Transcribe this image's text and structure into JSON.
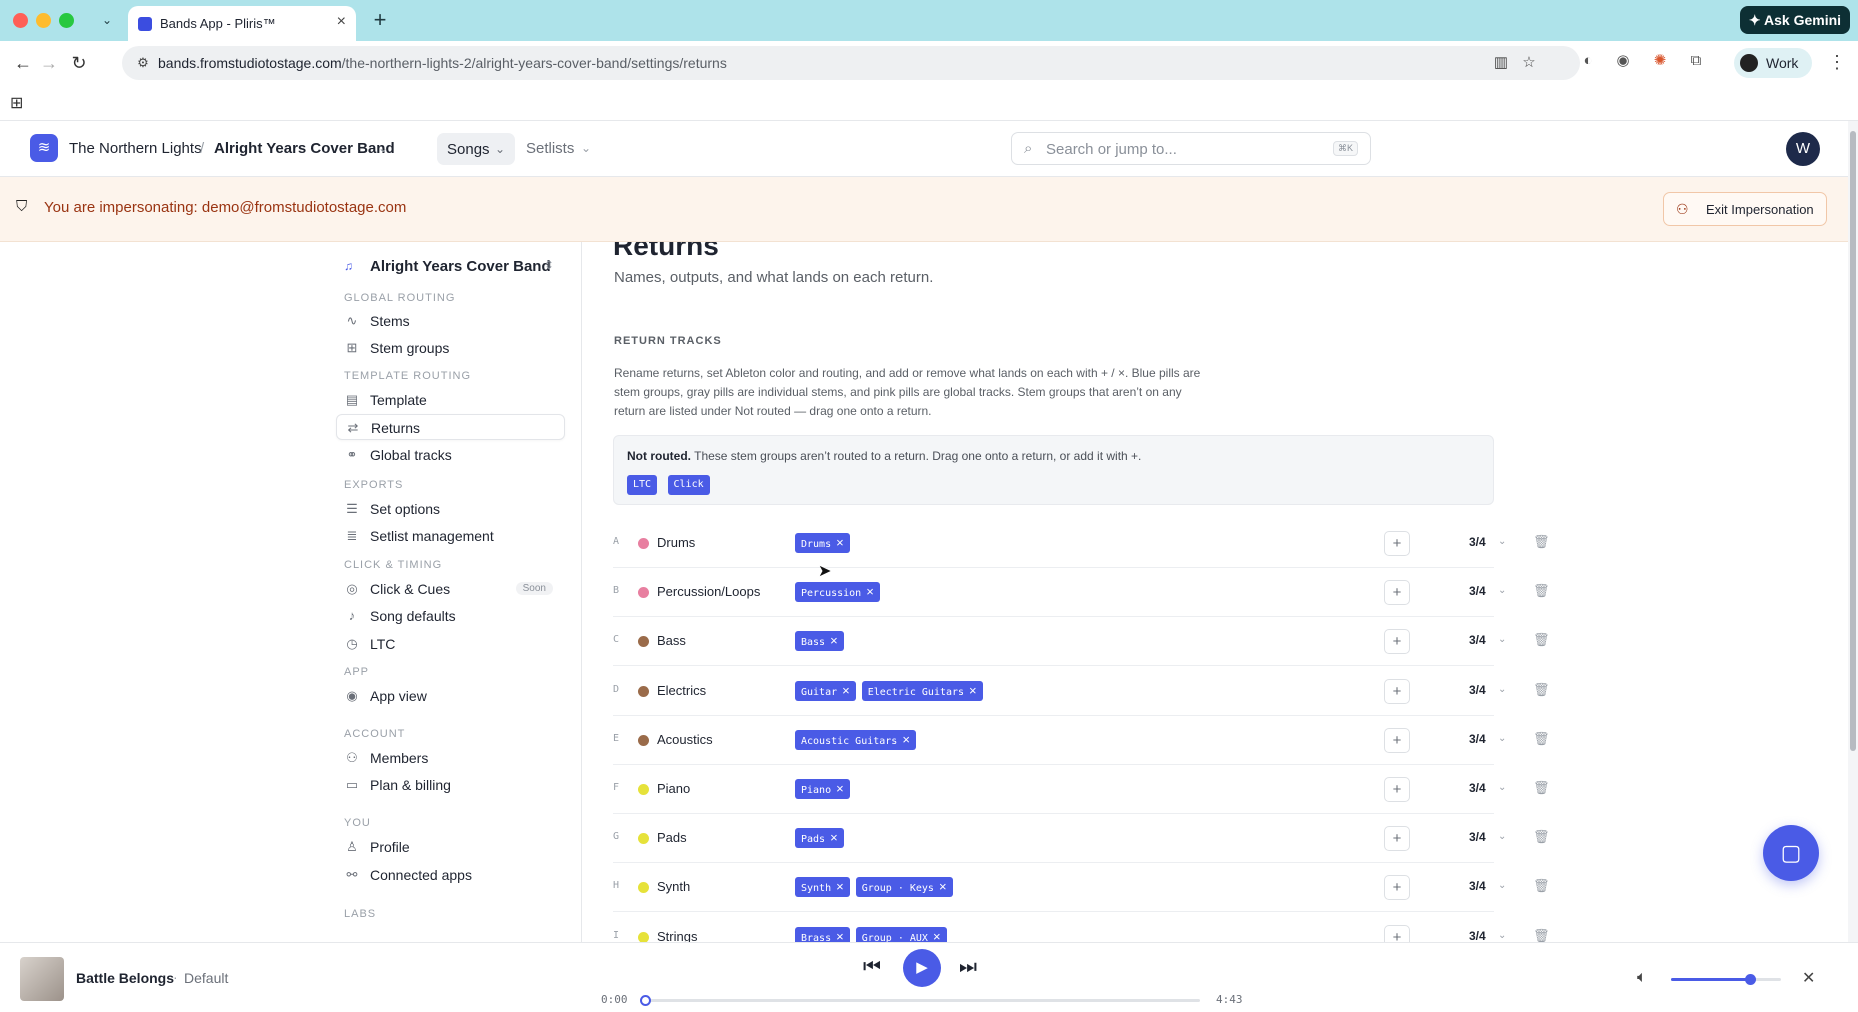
{
  "browser": {
    "tab_title": "Bands App - Pliris™",
    "url_host": "bands.fromstudiotostage.com",
    "url_path": "/the-northern-lights-2/alright-years-cover-band/settings/returns",
    "gemini_label": "Ask Gemini",
    "profile_label": "Work"
  },
  "header": {
    "org": "The Northern Lights",
    "separator": "/",
    "band": "Alright Years Cover Band",
    "nav_songs": "Songs",
    "nav_setlists": "Setlists",
    "search_placeholder": "Search or jump to...",
    "search_shortcut": "⌘K",
    "avatar_initial": "W"
  },
  "banner": {
    "text": "You are impersonating: demo@fromstudiotostage.com",
    "exit_label": "Exit Impersonation"
  },
  "sidebar": {
    "band_switcher": "Alright Years Cover Band",
    "sections": {
      "global_routing": "GLOBAL ROUTING",
      "template_routing": "TEMPLATE ROUTING",
      "exports": "EXPORTS",
      "click_timing": "CLICK & TIMING",
      "app": "APP",
      "account": "ACCOUNT",
      "you": "YOU",
      "labs": "LABS"
    },
    "items": {
      "stems": "Stems",
      "stem_groups": "Stem groups",
      "template": "Template",
      "returns": "Returns",
      "global_tracks": "Global tracks",
      "set_options": "Set options",
      "setlist_management": "Setlist management",
      "click_cues": "Click & Cues",
      "click_cues_badge": "Soon",
      "song_defaults": "Song defaults",
      "ltc": "LTC",
      "app_view": "App view",
      "members": "Members",
      "plan_billing": "Plan & billing",
      "profile": "Profile",
      "connected_apps": "Connected apps"
    }
  },
  "main": {
    "title": "Returns",
    "subtitle": "Names, outputs, and what lands on each return.",
    "section_title": "RETURN TRACKS",
    "section_desc": "Rename returns, set Ableton color and routing, and add or remove what lands on each with + / ×. Blue pills are stem groups, gray pills are individual stems, and pink pills are global tracks. Stem groups that aren’t on any return are listed under Not routed — drag one onto a return.",
    "not_routed_label": "Not routed.",
    "not_routed_text": "These stem groups aren’t routed to a return. Drag one onto a return, or add it with +.",
    "not_routed_pills": [
      "LTC",
      "Click"
    ],
    "returns": [
      {
        "letter": "A",
        "name": "Drums",
        "color": "#e87fa0",
        "pills": [
          "Drums"
        ],
        "signature": "3/4"
      },
      {
        "letter": "B",
        "name": "Percussion/Loops",
        "color": "#e87fa0",
        "pills": [
          "Percussion"
        ],
        "signature": "3/4"
      },
      {
        "letter": "C",
        "name": "Bass",
        "color": "#9a6b4a",
        "pills": [
          "Bass"
        ],
        "signature": "3/4"
      },
      {
        "letter": "D",
        "name": "Electrics",
        "color": "#9a6b4a",
        "pills": [
          "Guitar",
          "Electric Guitars"
        ],
        "signature": "3/4"
      },
      {
        "letter": "E",
        "name": "Acoustics",
        "color": "#9a6b4a",
        "pills": [
          "Acoustic Guitars"
        ],
        "signature": "3/4"
      },
      {
        "letter": "F",
        "name": "Piano",
        "color": "#e6e23a",
        "pills": [
          "Piano"
        ],
        "signature": "3/4"
      },
      {
        "letter": "G",
        "name": "Pads",
        "color": "#e6e23a",
        "pills": [
          "Pads"
        ],
        "signature": "3/4"
      },
      {
        "letter": "H",
        "name": "Synth",
        "color": "#e6e23a",
        "pills": [
          "Synth",
          "Group · Keys"
        ],
        "signature": "3/4"
      },
      {
        "letter": "I",
        "name": "Strings",
        "color": "#e6e23a",
        "pills": [
          "Brass",
          "Group · AUX"
        ],
        "signature": "3/4"
      }
    ]
  },
  "player": {
    "song": "Battle Belongs",
    "separator": "·",
    "setlist": "Default",
    "time_current": "0:00",
    "time_total": "4:43",
    "progress": 0.0,
    "volume": 0.72
  },
  "colors": {
    "accent": "#4a5be6",
    "banner_text": "#9a3412",
    "banner_bg": "#fdf4ec"
  }
}
